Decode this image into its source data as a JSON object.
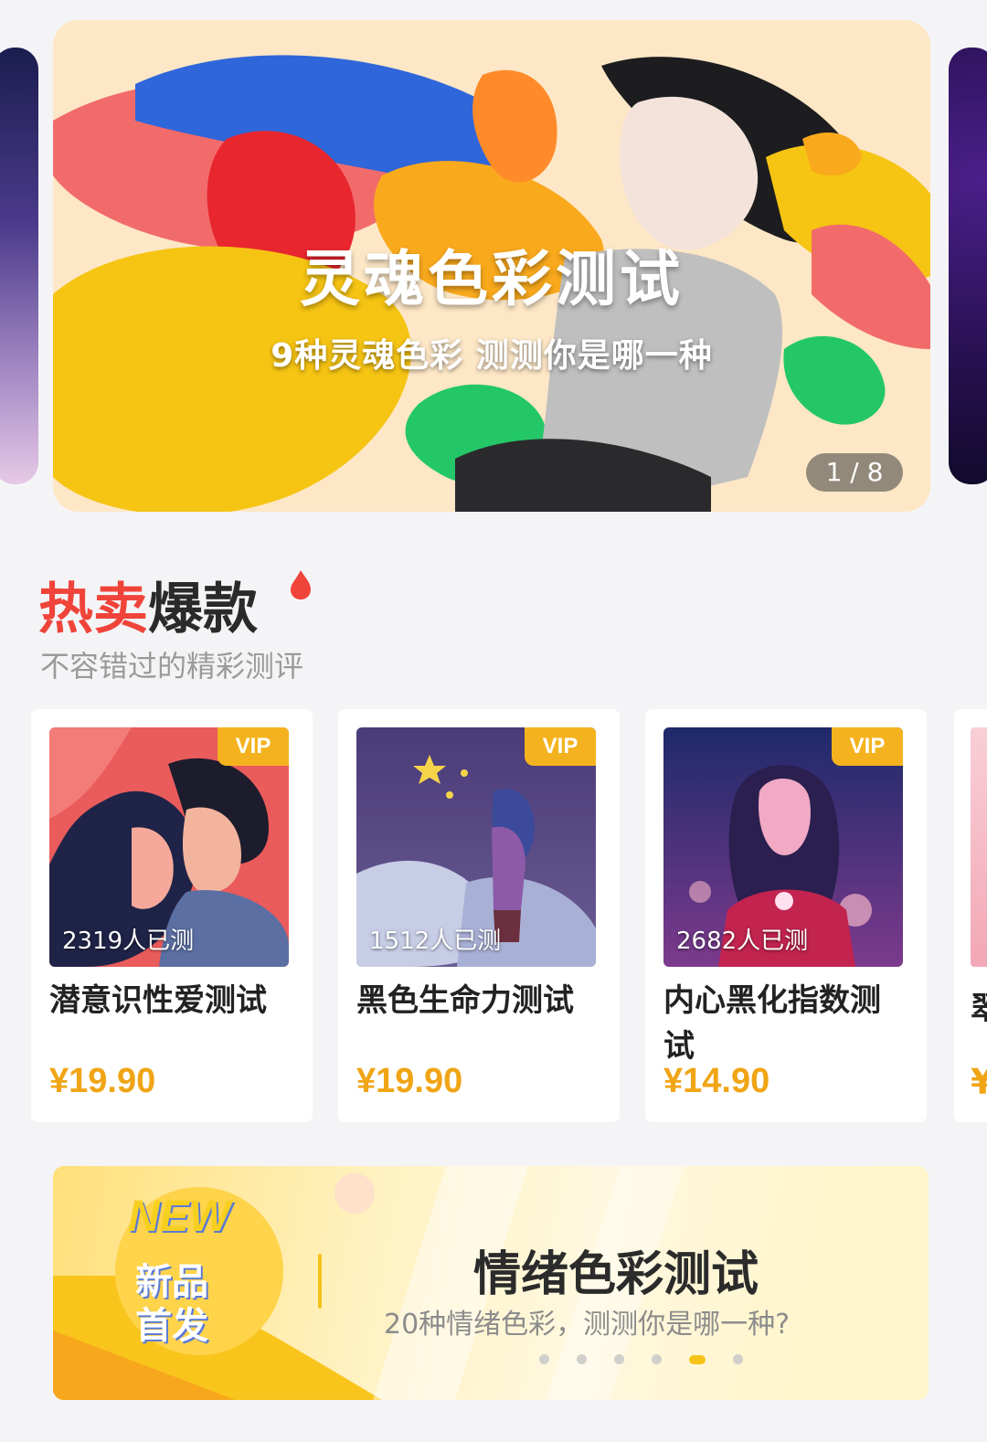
{
  "banner": {
    "title": "灵魂色彩测试",
    "subtitle": "9种灵魂色彩  测测你是哪一种",
    "pager": "1 / 8"
  },
  "section": {
    "title_hot": "热卖",
    "title_rest": "爆款",
    "subtitle": "不容错过的精彩测评"
  },
  "products": [
    {
      "badge": "VIP",
      "count": "2319人已测",
      "name": "潜意识性爱测试",
      "price": "¥19.90"
    },
    {
      "badge": "VIP",
      "count": "1512人已测",
      "name": "黑色生命力测试",
      "price": "¥19.90"
    },
    {
      "badge": "VIP",
      "count": "2682人已测",
      "name": "内心黑化指数测试",
      "price": "¥14.90"
    }
  ],
  "partial_card": {
    "name_glyph": "翠",
    "price_glyph": "¥"
  },
  "new_banner": {
    "badge_en": "NEW",
    "badge_cn_line1": "新品",
    "badge_cn_line2": "首发",
    "title": "情绪色彩测试",
    "subtitle": "20种情绪色彩，测测你是哪一种?",
    "active_dot_index": 4,
    "dot_count": 6
  },
  "colors": {
    "accent_red": "#f0443a",
    "price_orange": "#f0a516",
    "vip_gold": "#f4b31e"
  }
}
